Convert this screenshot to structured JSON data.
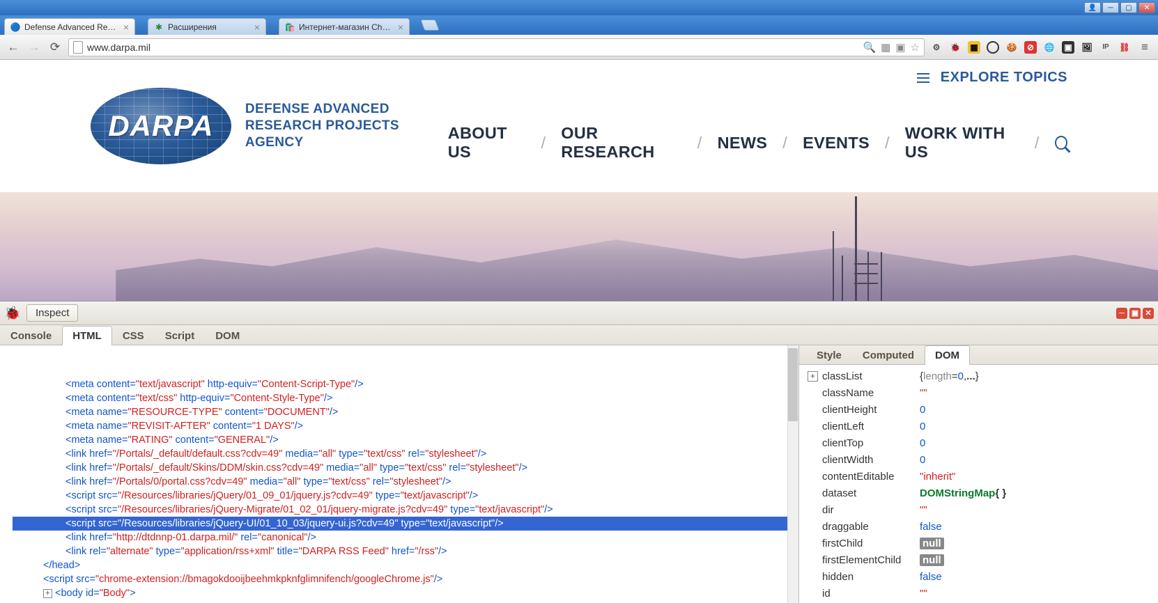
{
  "window": {
    "title": "Defense Advanced Resear"
  },
  "tabs": [
    {
      "label": "Defense Advanced Resear",
      "active": true
    },
    {
      "label": "Расширения",
      "active": false
    },
    {
      "label": "Интернет-магазин Chron",
      "active": false
    }
  ],
  "url": "www.darpa.mil",
  "site": {
    "logo_text": "DARPA",
    "agency_line1": "DEFENSE ADVANCED",
    "agency_line2": "RESEARCH PROJECTS AGENCY",
    "explore": "EXPLORE TOPICS",
    "nav": [
      "ABOUT US",
      "OUR RESEARCH",
      "NEWS",
      "EVENTS",
      "WORK WITH US"
    ]
  },
  "devtools": {
    "inspect": "Inspect",
    "left_tabs": [
      "Console",
      "HTML",
      "CSS",
      "Script",
      "DOM"
    ],
    "left_active": "HTML",
    "right_tabs": [
      "Style",
      "Computed",
      "DOM"
    ],
    "right_active": "DOM",
    "html_lines": [
      {
        "indent": 2,
        "html": "<span class='tag'>&lt;meta</span> <span class='attr'>content=</span><span class='val'>\"text/javascript\"</span> <span class='attr'>http-equiv=</span><span class='val'>\"Content-Script-Type\"</span><span class='tag'>/&gt;</span>"
      },
      {
        "indent": 2,
        "html": "<span class='tag'>&lt;meta</span> <span class='attr'>content=</span><span class='val'>\"text/css\"</span> <span class='attr'>http-equiv=</span><span class='val'>\"Content-Style-Type\"</span><span class='tag'>/&gt;</span>"
      },
      {
        "indent": 2,
        "html": "<span class='tag'>&lt;meta</span> <span class='attr'>name=</span><span class='val'>\"RESOURCE-TYPE\"</span> <span class='attr'>content=</span><span class='val'>\"DOCUMENT\"</span><span class='tag'>/&gt;</span>"
      },
      {
        "indent": 2,
        "html": "<span class='tag'>&lt;meta</span> <span class='attr'>name=</span><span class='val'>\"REVISIT-AFTER\"</span> <span class='attr'>content=</span><span class='val'>\"1 DAYS\"</span><span class='tag'>/&gt;</span>"
      },
      {
        "indent": 2,
        "html": "<span class='tag'>&lt;meta</span> <span class='attr'>name=</span><span class='val'>\"RATING\"</span> <span class='attr'>content=</span><span class='val'>\"GENERAL\"</span><span class='tag'>/&gt;</span>"
      },
      {
        "indent": 2,
        "html": "<span class='tag'>&lt;link</span> <span class='attr'>href=</span><span class='val'>\"/Portals/_default/default.css?cdv=49\"</span> <span class='attr'>media=</span><span class='val'>\"all\"</span> <span class='attr'>type=</span><span class='val'>\"text/css\"</span> <span class='attr'>rel=</span><span class='val'>\"stylesheet\"</span><span class='tag'>/&gt;</span>"
      },
      {
        "indent": 2,
        "html": "<span class='tag'>&lt;link</span> <span class='attr'>href=</span><span class='val'>\"/Portals/_default/Skins/DDM/skin.css?cdv=49\"</span> <span class='attr'>media=</span><span class='val'>\"all\"</span> <span class='attr'>type=</span><span class='val'>\"text/css\"</span> <span class='attr'>rel=</span><span class='val'>\"stylesheet\"</span><span class='tag'>/&gt;</span>"
      },
      {
        "indent": 2,
        "html": "<span class='tag'>&lt;link</span> <span class='attr'>href=</span><span class='val'>\"/Portals/0/portal.css?cdv=49\"</span> <span class='attr'>media=</span><span class='val'>\"all\"</span> <span class='attr'>type=</span><span class='val'>\"text/css\"</span> <span class='attr'>rel=</span><span class='val'>\"stylesheet\"</span><span class='tag'>/&gt;</span>"
      },
      {
        "indent": 2,
        "html": "<span class='tag'>&lt;script</span> <span class='attr'>src=</span><span class='val'>\"/Resources/libraries/jQuery/01_09_01/jquery.js?cdv=49\"</span> <span class='attr'>type=</span><span class='val'>\"text/javascript\"</span><span class='tag'>/&gt;</span>"
      },
      {
        "indent": 2,
        "html": "<span class='tag'>&lt;script</span> <span class='attr'>src=</span><span class='val'>\"/Resources/libraries/jQuery-Migrate/01_02_01/jquery-migrate.js?cdv=49\"</span> <span class='attr'>type=</span><span class='val'>\"text/javascript\"</span><span class='tag'>/&gt;</span>"
      },
      {
        "indent": 2,
        "selected": true,
        "html": "<span class='tag'>&lt;script</span> <span class='attr'>src=</span><span class='val'>\"/Resources/libraries/jQuery-UI/01_10_03/jquery-ui.js?cdv=49\"</span> <span class='attr'>type=</span><span class='val'>\"text/javascript\"</span><span class='tag'>/&gt;</span>"
      },
      {
        "indent": 2,
        "html": "<span class='tag'>&lt;link</span> <span class='attr'>href=</span><span class='val'>\"http://dtdnnp-01.darpa.mil/\"</span> <span class='attr'>rel=</span><span class='val'>\"canonical\"</span><span class='tag'>/&gt;</span>"
      },
      {
        "indent": 2,
        "html": "<span class='tag'>&lt;link</span> <span class='attr'>rel=</span><span class='val'>\"alternate\"</span> <span class='attr'>type=</span><span class='val'>\"application/rss+xml\"</span> <span class='attr'>title=</span><span class='val'>\"DARPA RSS Feed\"</span> <span class='attr'>href=</span><span class='val'>\"/rss\"</span><span class='tag'>/&gt;</span>"
      },
      {
        "indent": 1,
        "html": "<span class='tag'>&lt;/head&gt;</span>"
      },
      {
        "indent": 1,
        "html": "<span class='tag'>&lt;script</span> <span class='attr'>src=</span><span class='val'>\"chrome-extension://bmagokdooijbeehmkpknfglimnifench/googleChrome.js\"</span><span class='tag'>/&gt;</span>"
      },
      {
        "indent": 1,
        "expander": true,
        "html": "<span class='tag'>&lt;body</span> <span class='attr'>id=</span><span class='val'>\"Body\"</span><span class='tag'>&gt;</span>"
      }
    ],
    "dom_props": [
      {
        "key": "classList",
        "type": "special",
        "val": "{ length=0, ... }",
        "expander": true
      },
      {
        "key": "className",
        "type": "str",
        "val": "\"\""
      },
      {
        "key": "clientHeight",
        "type": "num",
        "val": "0"
      },
      {
        "key": "clientLeft",
        "type": "num",
        "val": "0"
      },
      {
        "key": "clientTop",
        "type": "num",
        "val": "0"
      },
      {
        "key": "clientWidth",
        "type": "num",
        "val": "0"
      },
      {
        "key": "contentEditable",
        "type": "str",
        "val": "\"inherit\""
      },
      {
        "key": "dataset",
        "type": "obj",
        "val": "DOMStringMap { }"
      },
      {
        "key": "dir",
        "type": "str",
        "val": "\"\""
      },
      {
        "key": "draggable",
        "type": "bool",
        "val": "false"
      },
      {
        "key": "firstChild",
        "type": "null",
        "val": "null"
      },
      {
        "key": "firstElementChild",
        "type": "null",
        "val": "null"
      },
      {
        "key": "hidden",
        "type": "bool",
        "val": "false"
      },
      {
        "key": "id",
        "type": "str",
        "val": "\"\""
      }
    ]
  }
}
